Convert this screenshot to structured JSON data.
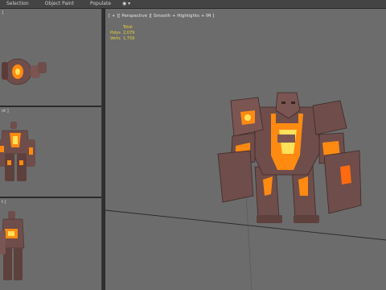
{
  "menubar": {
    "items": [
      "Selection",
      "Object Paint",
      "Populate"
    ],
    "camera_button": "◉ ▾"
  },
  "viewports": {
    "top": {
      "label": "]"
    },
    "front": {
      "label": "nt ]"
    },
    "left": {
      "label": "t ]"
    },
    "perspective": {
      "label": "[ + ][ Perspective ][ Smooth + Highlights + IM ]",
      "stats": [
        {
          "label": "",
          "value": "Total"
        },
        {
          "label": "Polys",
          "value": "2,079"
        },
        {
          "label": "Verts",
          "value": "1,759"
        }
      ]
    }
  },
  "colors": {
    "rock": "#6e4d4a",
    "rock_dark": "#4e3431",
    "lava": "#ff8a12",
    "lava_core": "#ffe15a",
    "viewport_bg": "#6c6c6c"
  }
}
